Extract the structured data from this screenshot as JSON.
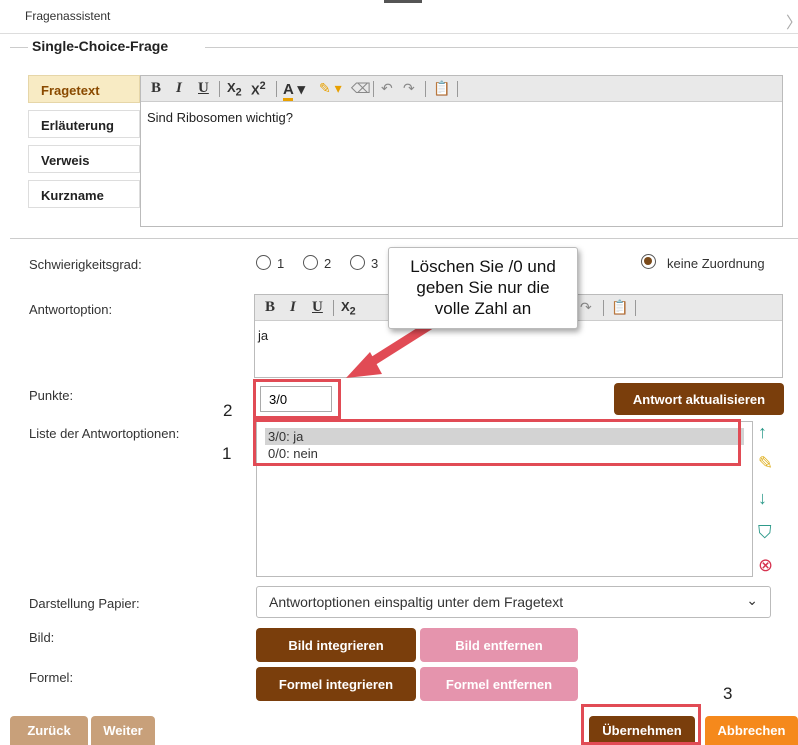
{
  "dialog": {
    "title": "Fragenassistent",
    "close_glyph": "〉"
  },
  "section": {
    "legend": "Single-Choice-Frage"
  },
  "tabs": [
    {
      "label": "Fragetext",
      "active": true
    },
    {
      "label": "Erläuterung"
    },
    {
      "label": "Verweis"
    },
    {
      "label": "Kurzname"
    }
  ],
  "question_editor": {
    "content": "Sind Ribosomen wichtig?"
  },
  "difficulty": {
    "label": "Schwierigkeitsgrad:",
    "options": [
      "1",
      "2",
      "3"
    ],
    "none_label": "keine Zuordnung"
  },
  "answer_option": {
    "label": "Antwortoption:",
    "content": "ja"
  },
  "points": {
    "label": "Punkte:",
    "value": "3/0",
    "update_button": "Antwort aktualisieren"
  },
  "options_list": {
    "label": "Liste der Antwortoptionen:",
    "items": [
      {
        "text": "3/0: ja",
        "selected": true
      },
      {
        "text": "0/0: nein",
        "selected": false
      }
    ]
  },
  "paper_display": {
    "label": "Darstellung Papier:",
    "selected": "Antwortoptionen einspaltig unter dem Fragetext"
  },
  "image": {
    "label": "Bild:",
    "integrate": "Bild integrieren",
    "remove": "Bild entfernen"
  },
  "formula": {
    "label": "Formel:",
    "integrate": "Formel integrieren",
    "remove": "Formel entfernen"
  },
  "footer": {
    "back": "Zurück",
    "next": "Weiter",
    "apply": "Übernehmen",
    "cancel": "Abbrechen"
  },
  "annotations": {
    "callout": "Löschen Sie /0 und geben Sie nur die volle Zahl an",
    "step1": "1",
    "step2": "2",
    "step3": "3"
  },
  "colors": {
    "brand_brown": "#7a3e0c",
    "pink": "#e594ad",
    "orange": "#f5891c",
    "annotation_red": "#e14b55"
  }
}
